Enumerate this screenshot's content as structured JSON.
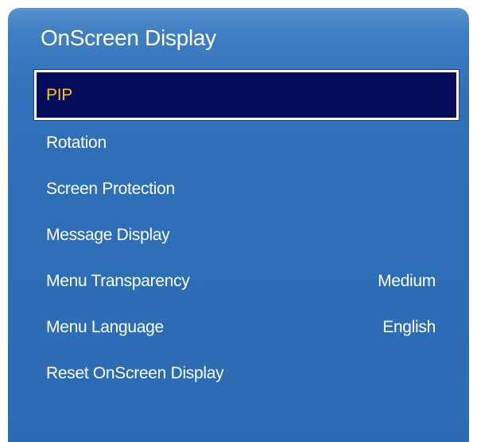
{
  "osd": {
    "title": "OnScreen Display",
    "items": [
      {
        "label": "PIP",
        "value": "",
        "selected": true
      },
      {
        "label": "Rotation",
        "value": ""
      },
      {
        "label": "Screen Protection",
        "value": ""
      },
      {
        "label": "Message Display",
        "value": ""
      },
      {
        "label": "Menu Transparency",
        "value": "Medium"
      },
      {
        "label": "Menu Language",
        "value": "English"
      },
      {
        "label": "Reset OnScreen Display",
        "value": ""
      }
    ]
  },
  "colors": {
    "panel_background": "#2c6bb3",
    "selected_background": "#050a5a",
    "selected_text": "#ffc21a",
    "text": "#ffffff"
  }
}
